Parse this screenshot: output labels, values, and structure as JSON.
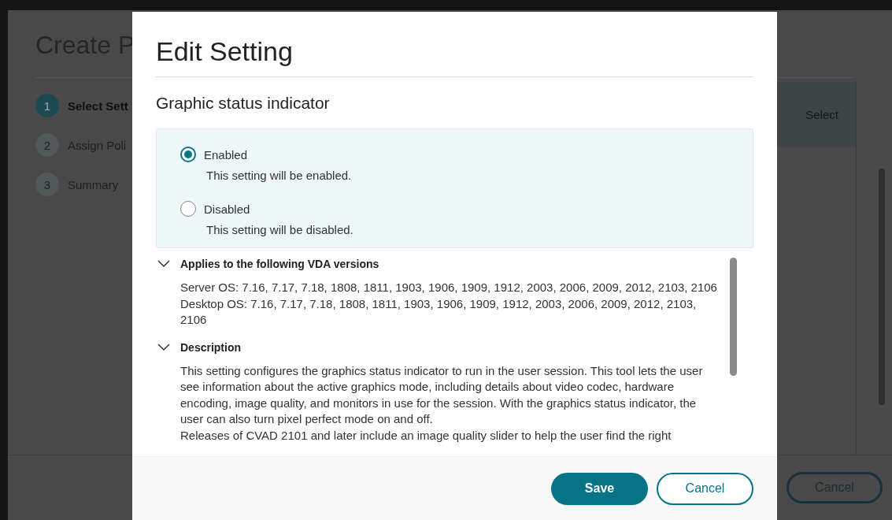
{
  "background_page": {
    "title": "Create P",
    "steps": [
      {
        "number": "1",
        "label": "Select Sett",
        "selected": true
      },
      {
        "number": "2",
        "label": "Assign Poli",
        "selected": false
      },
      {
        "number": "3",
        "label": "Summary",
        "selected": false
      }
    ],
    "column_header": "Select",
    "cancel_button": "Cancel"
  },
  "dialog": {
    "title": "Edit Setting",
    "setting_name": "Graphic status indicator",
    "options": [
      {
        "label": "Enabled",
        "hint": "This setting will be enabled.",
        "selected": true
      },
      {
        "label": "Disabled",
        "hint": "This setting will be disabled.",
        "selected": false
      }
    ],
    "sections": [
      {
        "title": "Applies to the following VDA versions",
        "expanded": true,
        "lines": [
          "Server OS: 7.16, 7.17, 7.18, 1808, 1811, 1903, 1906, 1909, 1912, 2003, 2006, 2009, 2012, 2103, 2106",
          "Desktop OS: 7.16, 7.17, 7.18, 1808, 1811, 1903, 1906, 1909, 1912, 2003, 2006, 2009, 2012, 2103, 2106"
        ]
      },
      {
        "title": "Description",
        "expanded": true,
        "lines": [
          "This setting configures the graphics status indicator to run in the user session. This tool lets the user see information about the active graphics mode, including details about video codec, hardware encoding, image quality, and monitors in use for the session. With the graphics status indicator, the user can also turn pixel perfect mode on and off.",
          "Releases of CVAD 2101 and later include an image quality slider to help the user find the right"
        ]
      }
    ],
    "save_button": "Save",
    "cancel_button": "Cancel"
  }
}
